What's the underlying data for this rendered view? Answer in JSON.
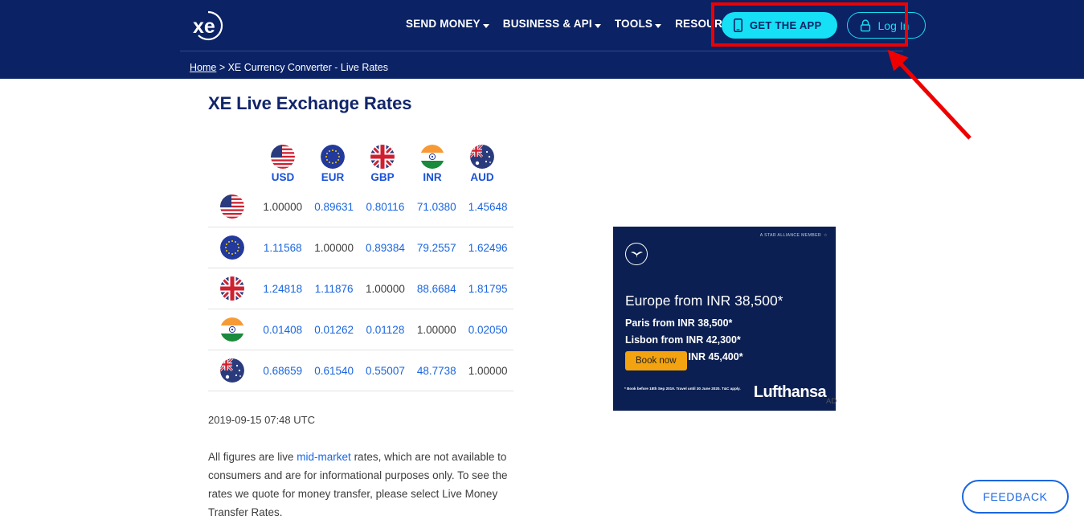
{
  "header": {
    "logo_alt": "xe",
    "nav": [
      {
        "label": "SEND MONEY"
      },
      {
        "label": "BUSINESS & API"
      },
      {
        "label": "TOOLS"
      },
      {
        "label": "RESOURCES"
      }
    ],
    "get_app_label": "GET THE APP",
    "login_label": "Log In",
    "breadcrumb_home": "Home",
    "breadcrumb_rest": " > XE Currency Converter - Live Rates"
  },
  "main": {
    "title": "XE Live Exchange Rates",
    "timestamp": "2019-09-15 07:48 UTC",
    "disclaimer_pre": "All figures are live ",
    "disclaimer_link": "mid-market",
    "disclaimer_post": " rates, which are not available to consumers and are for informational purposes only. To see the rates we quote for money transfer, please select Live Money Transfer Rates."
  },
  "rates_table": {
    "columns": [
      "USD",
      "EUR",
      "GBP",
      "INR",
      "AUD"
    ],
    "rows": [
      {
        "currency": "USD",
        "values": [
          "1.00000",
          "0.89631",
          "0.80116",
          "71.0380",
          "1.45648"
        ]
      },
      {
        "currency": "EUR",
        "values": [
          "1.11568",
          "1.00000",
          "0.89384",
          "79.2557",
          "1.62496"
        ]
      },
      {
        "currency": "GBP",
        "values": [
          "1.24818",
          "1.11876",
          "1.00000",
          "88.6684",
          "1.81795"
        ]
      },
      {
        "currency": "INR",
        "values": [
          "0.01408",
          "0.01262",
          "0.01128",
          "1.00000",
          "0.02050"
        ]
      },
      {
        "currency": "AUD",
        "values": [
          "0.68659",
          "0.61540",
          "0.55007",
          "48.7738",
          "1.00000"
        ]
      }
    ]
  },
  "ad": {
    "star_alliance": "A STAR ALLIANCE MEMBER",
    "headline": "Europe from INR 38,500*",
    "line1": "Paris from INR 38,500*",
    "line2": "Lisbon from INR 42,300*",
    "line3": "Munich from INR 45,400*",
    "book_label": "Book now",
    "fine_print": "* Book before 18th Sep 2019. Travel until 30 June 2020. T&C apply.",
    "brand": "Lufthansa",
    "ad_label": "AD"
  },
  "feedback": {
    "label": "FEEDBACK"
  },
  "colors": {
    "header_bg": "#0b2265",
    "accent_cyan": "#16e0f5",
    "link_blue": "#1a66e0",
    "annotation_red": "#ee0000",
    "ad_bg": "#0b1f52",
    "ad_button": "#f2a30f"
  }
}
